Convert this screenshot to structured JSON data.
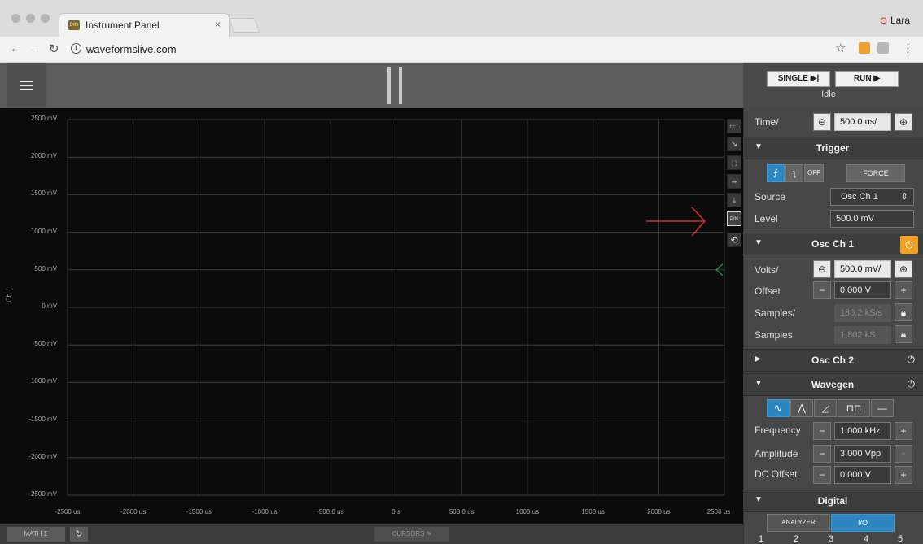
{
  "browser": {
    "tab_title": "Instrument Panel",
    "tab_close": "×",
    "profile_name": "Lara",
    "url": "waveformslive.com",
    "favicon_text": "DIG"
  },
  "plot": {
    "channel_label": "Ch 1",
    "y_labels": [
      "2500 mV",
      "2000 mV",
      "1500 mV",
      "1000 mV",
      "500 mV",
      "0 mV",
      "-500 mV",
      "-1000 mV",
      "-1500 mV",
      "-2000 mV",
      "-2500 mV"
    ],
    "x_labels": [
      "-2500 us",
      "-2000 us",
      "-1500 us",
      "-1000 us",
      "-500.0 us",
      "0 s",
      "500.0 us",
      "1000 us",
      "1500 us",
      "2000 us",
      "2500 us"
    ],
    "tool_fft": "FFT",
    "tool_pin": "PIN",
    "trace_color": "#1fa34a",
    "annotation_color": "#d62a2a"
  },
  "bottom": {
    "math_label": "MATH",
    "cursors_label": "CURSORS"
  },
  "side": {
    "single_label": "SINGLE",
    "run_label": "RUN",
    "status": "Idle",
    "time_label": "Time/",
    "time_value": "500.0 us/",
    "trigger": {
      "title": "Trigger",
      "off_label": "OFF",
      "force_label": "FORCE",
      "source_label": "Source",
      "source_value": "Osc Ch 1",
      "level_label": "Level",
      "level_value": "500.0 mV"
    },
    "osc1": {
      "title": "Osc Ch 1",
      "volts_label": "Volts/",
      "volts_value": "500.0 mV/",
      "offset_label": "Offset",
      "offset_value": "0.000 V",
      "samples_rate_label": "Samples/",
      "samples_rate_value": "180.2 kS/s",
      "samples_label": "Samples",
      "samples_value": "1.802 kS"
    },
    "osc2": {
      "title": "Osc Ch 2"
    },
    "wavegen": {
      "title": "Wavegen",
      "frequency_label": "Frequency",
      "frequency_value": "1.000 kHz",
      "amplitude_label": "Amplitude",
      "amplitude_value": "3.000 Vpp",
      "dcoffset_label": "DC Offset",
      "dcoffset_value": "0.000 V"
    },
    "digital": {
      "title": "Digital",
      "analyzer_label": "ANALYZER",
      "io_label": "I/O",
      "pins": [
        "1",
        "2",
        "3",
        "4",
        "5"
      ]
    }
  }
}
